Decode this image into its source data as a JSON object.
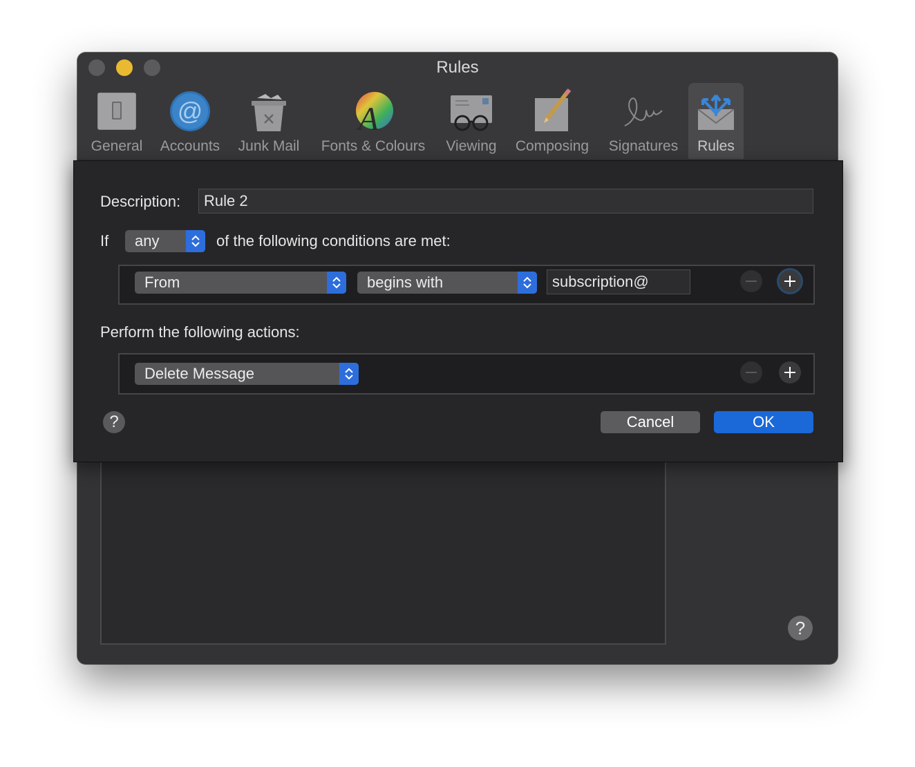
{
  "window": {
    "title": "Rules",
    "traffic_lights": [
      "close",
      "minimize",
      "zoom"
    ],
    "toolbar": [
      {
        "label": "General",
        "icon": "general-icon"
      },
      {
        "label": "Accounts",
        "icon": "accounts-icon"
      },
      {
        "label": "Junk Mail",
        "icon": "junk-mail-icon"
      },
      {
        "label": "Fonts & Colours",
        "icon": "fonts-colours-icon"
      },
      {
        "label": "Viewing",
        "icon": "viewing-icon"
      },
      {
        "label": "Composing",
        "icon": "composing-icon"
      },
      {
        "label": "Signatures",
        "icon": "signatures-icon"
      },
      {
        "label": "Rules",
        "icon": "rules-icon",
        "selected": true
      }
    ],
    "background_help": "?"
  },
  "sheet": {
    "description_label": "Description:",
    "description_value": "Rule 2",
    "if_label": "If",
    "match_mode": "any",
    "conditions_suffix": "of the following conditions are met:",
    "conditions": [
      {
        "field": "From",
        "operator": "begins with",
        "value": "subscription@"
      }
    ],
    "actions_label": "Perform the following actions:",
    "actions": [
      {
        "action": "Delete Message"
      }
    ],
    "help": "?",
    "cancel_label": "Cancel",
    "ok_label": "OK"
  },
  "colors": {
    "accent": "#2d6edc",
    "ok_button": "#1b68d8",
    "minimize_light": "#e9b931"
  }
}
